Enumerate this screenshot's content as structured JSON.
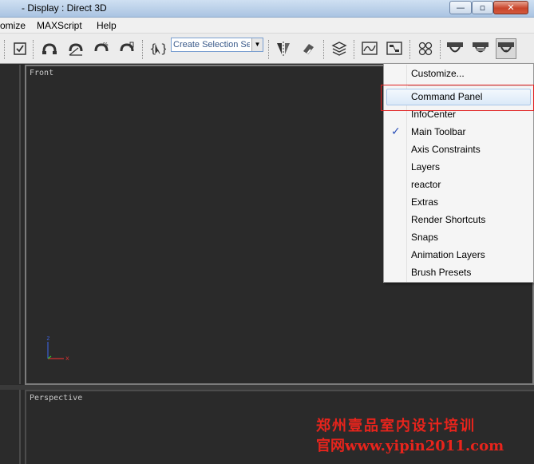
{
  "window": {
    "title": "- Display : Direct 3D",
    "buttons": {
      "minimize": "—",
      "maximize": "▫",
      "close": "✕"
    }
  },
  "menubar": {
    "items": [
      "omize",
      "MAXScript",
      "Help"
    ]
  },
  "toolbar": {
    "selection_set_value": "Create Selection Set",
    "icons": [
      "select-object-icon",
      "snap-3d-icon",
      "angle-snap-icon",
      "percent-snap-icon",
      "spinner-snap-icon",
      "named-selection-icon",
      "mirror-icon",
      "align-icon",
      "layer-manager-icon",
      "curve-editor-icon",
      "schematic-view-icon",
      "material-editor-icon",
      "render-setup-icon",
      "rendered-frame-icon",
      "quick-render-icon"
    ]
  },
  "viewports": {
    "front_label": "Front",
    "perspective_label": "Perspective",
    "axis": {
      "z": "z",
      "x": "x"
    }
  },
  "dropdown": {
    "items": [
      {
        "label": "Customize...",
        "checked": false
      },
      {
        "label": "Command Panel",
        "checked": false,
        "highlighted": true
      },
      {
        "label": "InfoCenter",
        "checked": false
      },
      {
        "label": "Main Toolbar",
        "checked": true
      },
      {
        "label": "Axis Constraints",
        "checked": false
      },
      {
        "label": "Layers",
        "checked": false
      },
      {
        "label": "reactor",
        "checked": false
      },
      {
        "label": "Extras",
        "checked": false
      },
      {
        "label": "Render Shortcuts",
        "checked": false
      },
      {
        "label": "Snaps",
        "checked": false
      },
      {
        "label": "Animation Layers",
        "checked": false
      },
      {
        "label": "Brush Presets",
        "checked": false
      }
    ],
    "check_glyph": "✓"
  },
  "watermark": {
    "line1": "郑州壹品室内设计培训",
    "line2": "官网www.yipin2011.com"
  },
  "colors": {
    "viewport_bg": "#2a2a2a",
    "highlight_border": "#e02020",
    "watermark": "#e8241c"
  }
}
